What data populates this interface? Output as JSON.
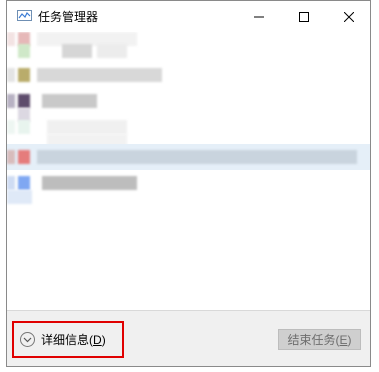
{
  "window": {
    "title": "任务管理器"
  },
  "title_buttons": {
    "minimize_glyph": "—",
    "maximize_glyph": "☐",
    "close_glyph": "✕"
  },
  "process_list": {
    "rows": [
      {
        "icon_color": "#e6b8b8",
        "label_color": "#e0e0e0"
      },
      {
        "icon_color": "#cfe8c8",
        "label_color": "#dcdcdc"
      },
      {
        "icon_color": "#b9ac6b",
        "label_color": "#d4d4d4"
      },
      {
        "icon_color": "#5e4c6c",
        "label_color": "#c8c8c8"
      },
      {
        "icon_color": "#e8f4ee",
        "label_color": "#e8e8e8"
      },
      {
        "icon_color": "#e57c7c",
        "label_color": "#c8d6e2"
      },
      {
        "icon_color": "#7fa7f2",
        "label_color": "#bdbdbd"
      }
    ],
    "selected_row_color": "#e5eff8"
  },
  "footer": {
    "details_label": "详细信息",
    "details_mnemonic": "D",
    "end_task_label": "结束任务",
    "end_task_mnemonic": "E"
  },
  "colors": {
    "highlight_border": "#e00000",
    "footer_bg": "#f0f0f0",
    "disabled_button_bg": "#cfcfcf"
  }
}
